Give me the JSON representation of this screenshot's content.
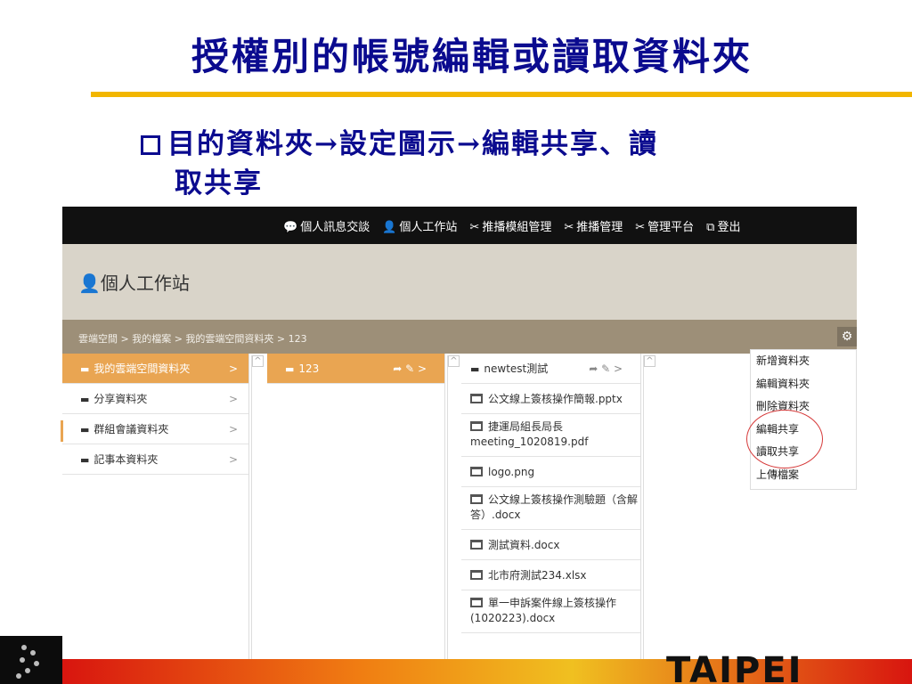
{
  "slide": {
    "title": "授權別的帳號編輯或讀取資料夾",
    "bullet_line1": "目的資料夾→設定圖示→編輯共享、讀",
    "bullet_line2": "取共享",
    "footer_word": "TAIPEI",
    "colors": {
      "title": "#0b0b8f",
      "rule": "#f2b600",
      "selected": "#e9a552",
      "crumbbar": "#9d8f78",
      "circle": "#d63a3a"
    }
  },
  "app": {
    "topnav": [
      {
        "icon": "chat-icon",
        "glyph": "💬",
        "label": "個人訊息交談"
      },
      {
        "icon": "user-icon",
        "glyph": "👤",
        "label": "個人工作站"
      },
      {
        "icon": "tools-icon",
        "glyph": "✂",
        "label": "推播模組管理"
      },
      {
        "icon": "tools-icon",
        "glyph": "✂",
        "label": "推播管理"
      },
      {
        "icon": "tools-icon",
        "glyph": "✂",
        "label": "管理平台"
      },
      {
        "icon": "external-link-icon",
        "glyph": "⧉",
        "label": "登出"
      }
    ],
    "workstation_title": "個人工作站",
    "breadcrumb": "雲端空間 > 我的檔案 > 我的雲端空間資料夾 > 123",
    "gear_glyph": "⚙",
    "col1": [
      {
        "label": "我的雲端空間資料夾",
        "selected": true
      },
      {
        "label": "分享資料夾",
        "selected": false
      },
      {
        "label": "群組會議資料夾",
        "selected": false
      },
      {
        "label": "記事本資料夾",
        "selected": false
      }
    ],
    "col2": [
      {
        "label": "123",
        "selected": true
      }
    ],
    "col3": [
      {
        "label": "newtest測試",
        "type": "folder"
      },
      {
        "label": "公文線上簽核操作簡報.pptx",
        "type": "file"
      },
      {
        "label": "捷運局組長局長meeting_1020819.pdf",
        "type": "file"
      },
      {
        "label": "logo.png",
        "type": "file"
      },
      {
        "label": "公文線上簽核操作測驗題（含解答）.docx",
        "type": "file"
      },
      {
        "label": "測試資料.docx",
        "type": "file"
      },
      {
        "label": "北市府測試234.xlsx",
        "type": "file"
      },
      {
        "label": "單一申訴案件線上簽核操作(1020223).docx",
        "type": "file"
      }
    ],
    "menu": [
      "新增資料夾",
      "編輯資料夾",
      "刪除資料夾",
      "編輯共享",
      "讀取共享",
      "上傳檔案"
    ],
    "scroll_up_glyph": "^",
    "chevron": ">",
    "row_actions": "➦ ✎ >"
  }
}
